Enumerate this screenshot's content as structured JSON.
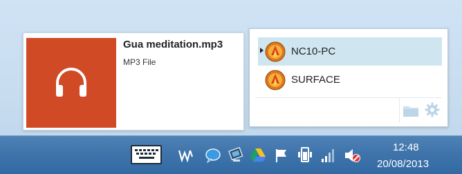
{
  "file_card": {
    "file_name": "Gua meditation.mp3",
    "file_type": "MP3 File",
    "thumbnail_icon": "headphones-icon",
    "thumbnail_color": "#d04a26"
  },
  "device_panel": {
    "devices": [
      {
        "label": "NC10-PC",
        "icon": "device-avatar-icon",
        "selected": true
      },
      {
        "label": "SURFACE",
        "icon": "device-avatar-icon",
        "selected": false
      }
    ],
    "footer": {
      "folder_icon": "folder-icon",
      "settings_icon": "gear-icon"
    },
    "selected_color": "#cfe6f0"
  },
  "taskbar": {
    "tray_icons": [
      "keyboard-icon",
      "app-logo-icon",
      "chat-bubble-icon",
      "network-monitor-icon",
      "google-drive-icon",
      "action-center-flag-icon",
      "power-plug-icon",
      "signal-bars-icon",
      "volume-muted-icon"
    ],
    "clock": {
      "time": "12:48",
      "date": "20/08/2013"
    },
    "background_color": "#3f74ab"
  }
}
